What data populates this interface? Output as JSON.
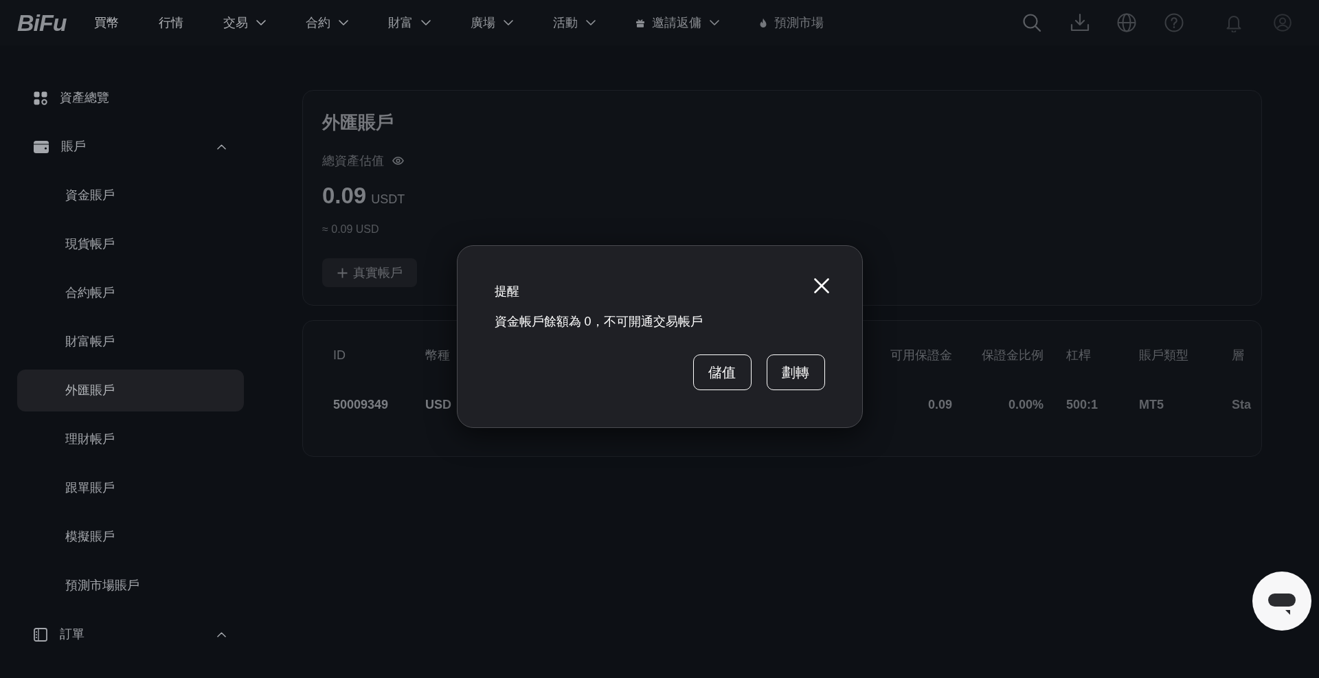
{
  "nav": {
    "logo": "BiFu",
    "items": [
      {
        "label": "買幣",
        "kind": "link"
      },
      {
        "label": "行情",
        "kind": "link"
      },
      {
        "label": "交易",
        "kind": "menu"
      },
      {
        "label": "合約",
        "kind": "menu"
      },
      {
        "label": "財富",
        "kind": "menu"
      },
      {
        "label": "廣場",
        "kind": "menu"
      },
      {
        "label": "活動",
        "kind": "menu"
      },
      {
        "label": "邀請返傭",
        "kind": "menu"
      },
      {
        "label": "預測市場",
        "kind": "link"
      }
    ]
  },
  "sidebar": {
    "items": [
      {
        "label": "資產總覽",
        "kind": "link",
        "selected": false
      },
      {
        "label": "賬戶",
        "kind": "group",
        "selected": false,
        "expanded": true,
        "children": [
          {
            "label": "資金賬戶",
            "selected": false
          },
          {
            "label": "現貨帳戶",
            "selected": false
          },
          {
            "label": "合約帳戶",
            "selected": false
          },
          {
            "label": "財富帳戶",
            "selected": false
          },
          {
            "label": "外匯賬戶",
            "selected": true
          },
          {
            "label": "理財帳戶",
            "selected": false
          },
          {
            "label": "跟單賬戶",
            "selected": false
          },
          {
            "label": "模擬賬戶",
            "selected": false
          },
          {
            "label": "預測市場賬戶",
            "selected": false
          }
        ]
      },
      {
        "label": "訂單",
        "kind": "group",
        "selected": false,
        "expanded": true
      }
    ]
  },
  "account_card": {
    "title": "外匯賬戶",
    "balance_label": "總資產估值",
    "balance": "0.09",
    "unit": "USDT",
    "approx": "≈ 0.09 USD",
    "add_button": "真實帳戶"
  },
  "accounts_table": {
    "columns": [
      "ID",
      "幣種",
      "可用保證金",
      "保證金比例",
      "杠桿",
      "賬戶類型",
      "層"
    ],
    "rows": [
      {
        "cells": [
          "50009349",
          "USD",
          "0.09",
          "0.00%",
          "500:1",
          "MT5",
          "Sta"
        ]
      }
    ]
  },
  "dialog": {
    "title": "提醒",
    "message": "資金帳戶餘額為 0，不可開通交易帳戶",
    "buttons": [
      "儲值",
      "劃轉"
    ]
  }
}
